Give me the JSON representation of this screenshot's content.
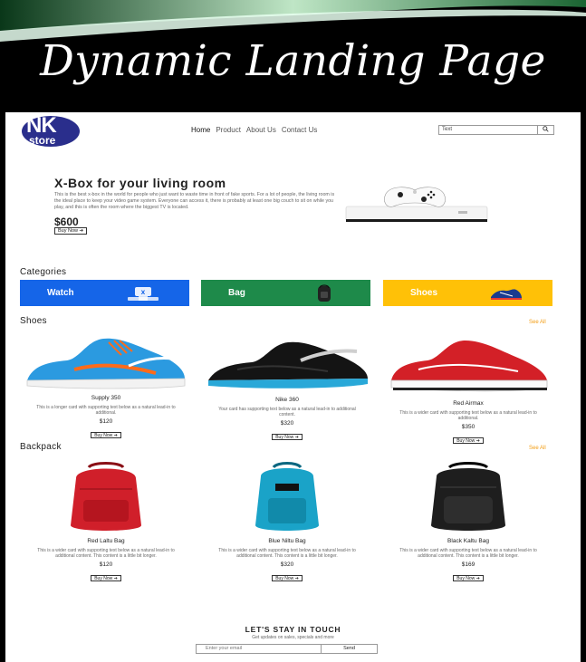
{
  "banner": {
    "title": "Dynamic Landing Page"
  },
  "nav": {
    "logo": {
      "brand": "NK",
      "sub": "store"
    },
    "links": [
      "Home",
      "Product",
      "About Us",
      "Contact Us"
    ],
    "search": {
      "value": "Text",
      "button_icon": "search-icon"
    }
  },
  "hero": {
    "title": "X-Box for your living room",
    "description": "This is the best x-box in the world for people who just want to waste time in front of fake sports. For a lot of people, the living room is the ideal place to keep your video game system. Everyone can access it, there is probably at least one big couch to sit on while you play, and this is often the room where the biggest TV is located.",
    "price": "$600",
    "buy_label": "Buy Now ➔"
  },
  "categories": {
    "title": "Categories",
    "items": [
      {
        "label": "Watch",
        "color": "#1565e8"
      },
      {
        "label": "Bag",
        "color": "#1e8a4a"
      },
      {
        "label": "Shoes",
        "color": "#ffc107"
      }
    ]
  },
  "shoes": {
    "title": "Shoes",
    "see_all": "See All",
    "items": [
      {
        "name": "Supply 350",
        "desc": "This is a longer card with supporting text below as a natural lead-in to additional.",
        "price": "$120",
        "buy": "Buy Now ➔"
      },
      {
        "name": "Nike 360",
        "desc": "Your card has supporting text below as a natural lead-in to additional content.",
        "price": "$320",
        "buy": "Buy Now ➔"
      },
      {
        "name": "Red Airmax",
        "desc": "This is a wider card with supporting text below as a natural lead-in to additional.",
        "price": "$350",
        "buy": "Buy Now ➔"
      }
    ]
  },
  "backpack": {
    "title": "Backpack",
    "see_all": "See All",
    "items": [
      {
        "name": "Red Laltu Bag",
        "desc": "This is a wider card with supporting text below as a natural lead-in to additional content. This content is a little bit longer.",
        "price": "$120",
        "buy": "Buy Now ➔"
      },
      {
        "name": "Blue Niltu Bag",
        "desc": "This is a wider card with supporting text below as a natural lead-in to additional content. This content is a little bit longer.",
        "price": "$320",
        "buy": "Buy Now ➔"
      },
      {
        "name": "Black Kaltu Bag",
        "desc": "This is a wider card with supporting text below as a natural lead-in to additional content. This content is a little bit longer.",
        "price": "$169",
        "buy": "Buy Now ➔"
      }
    ]
  },
  "newsletter": {
    "title": "LET'S STAY IN TOUCH",
    "subtitle": "Get updates on sales, specials and more",
    "placeholder": "Enter your email",
    "button": "Send"
  }
}
